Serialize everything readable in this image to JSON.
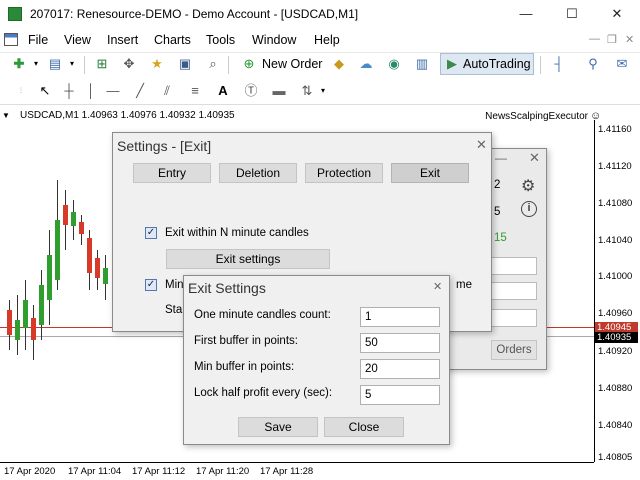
{
  "window": {
    "title": "207017: Renesource-DEMO - Demo Account - [USDCAD,M1]",
    "minimize": "—",
    "maximize": "☐",
    "close": "✕"
  },
  "menu": {
    "items": [
      "File",
      "View",
      "Insert",
      "Charts",
      "Tools",
      "Window",
      "Help"
    ],
    "mdi_controls": [
      "—",
      "❐",
      "✕"
    ]
  },
  "toolbar": {
    "new_order_label": "New Order",
    "autotrading_label": "AutoTrading"
  },
  "chart": {
    "header": "USDCAD,M1  1.40963 1.40976 1.40932 1.40935",
    "expert_name": "NewsScalpingExecutor",
    "price_labels": [
      "1.41160",
      "1.41120",
      "1.41080",
      "1.41040",
      "1.41000",
      "1.40960",
      "1.40920",
      "1.40880",
      "1.40840",
      "1.40805"
    ],
    "bid_tag": "1.40945",
    "ask_tag": "1.40935",
    "time_labels": [
      "17 Apr 2020",
      "17 Apr 11:04",
      "17 Apr 11:12",
      "17 Apr 11:20",
      "17 Apr 11:28"
    ],
    "colors": {
      "bull": "#2f9e2f",
      "bear": "#d83a2a",
      "bid_line": "#c0392b",
      "ask_line": "#888888"
    }
  },
  "bg_panel": {
    "values": [
      "2",
      "5",
      "15"
    ],
    "orders_label": "Orders"
  },
  "settings": {
    "title": "Settings - [Exit]",
    "tabs": [
      "Entry",
      "Deletion",
      "Protection",
      "Exit"
    ],
    "exit_within_label": "Exit within N minute candles",
    "exit_settings_label": "Exit settings",
    "min_label": "Min",
    "me_label": "me",
    "sta_label": "Sta"
  },
  "exit_settings": {
    "title": "Exit Settings",
    "fields": [
      {
        "label": "One minute candles count:",
        "value": "1"
      },
      {
        "label": "First buffer in points:",
        "value": "50"
      },
      {
        "label": "Min buffer in points:",
        "value": "20"
      },
      {
        "label": "Lock half profit every (sec):",
        "value": "5"
      }
    ],
    "save_label": "Save",
    "close_label": "Close"
  }
}
